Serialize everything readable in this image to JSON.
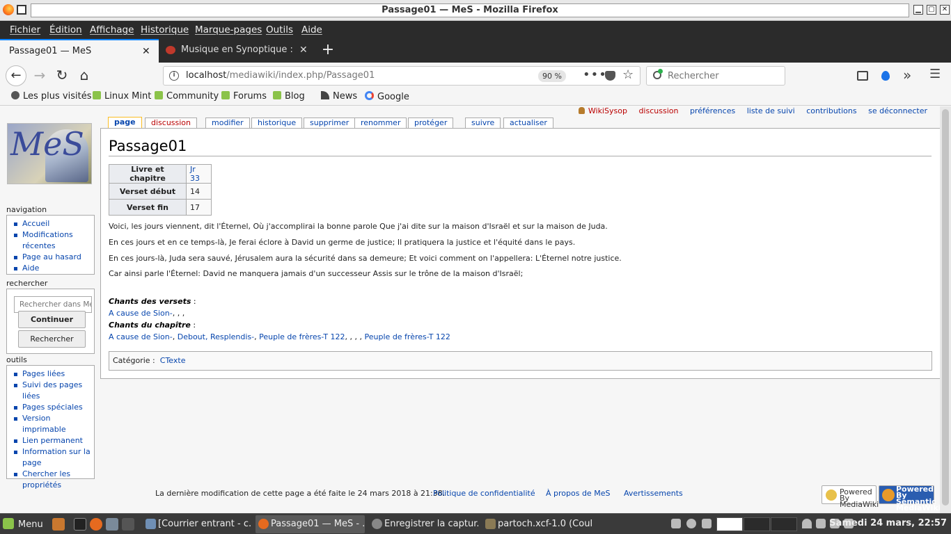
{
  "window": {
    "title": "Passage01 — MeS - Mozilla Firefox"
  },
  "menubar": [
    "Fichier",
    "Édition",
    "Affichage",
    "Historique",
    "Marque-pages",
    "Outils",
    "Aide"
  ],
  "tabs": [
    {
      "label": "Passage01 — MeS",
      "close": "✕"
    },
    {
      "label": "Musique en Synoptique : une",
      "close": "✕"
    }
  ],
  "newtab": "+",
  "nav": {
    "back": "←",
    "forward": "→",
    "reload": "↻",
    "home": "⌂",
    "url_host": "localhost",
    "url_path": "/mediawiki/index.php/Passage01",
    "zoom": "90 %",
    "more": "•••",
    "star": "☆",
    "search_placeholder": "Rechercher",
    "overflow": "»",
    "hamburger": "☰"
  },
  "bookmarks": [
    "Les plus visités",
    "Linux Mint",
    "Community",
    "Forums",
    "Blog",
    "News",
    "Google"
  ],
  "personal": {
    "user": "WikiSysop",
    "items": [
      "discussion",
      "préférences",
      "liste de suivi",
      "contributions",
      "se déconnecter"
    ]
  },
  "content_tabs": [
    "page",
    "discussion",
    "modifier",
    "historique",
    "supprimer",
    "renommer",
    "protéger",
    "suivre",
    "actualiser"
  ],
  "sidebar": {
    "logo_text": "MeS",
    "navigation": {
      "title": "navigation",
      "items": [
        "Accueil",
        "Modifications",
        "récentes",
        "Page au hasard",
        "Aide"
      ]
    },
    "search": {
      "title": "rechercher",
      "placeholder": "Rechercher dans MeS",
      "go": "Continuer",
      "search": "Rechercher"
    },
    "tools": {
      "title": "outils",
      "items": [
        "Pages liées",
        "Suivi des pages",
        "liées",
        "Pages spéciales",
        "Version imprimable",
        "Lien permanent",
        "Information sur la",
        "page",
        "Chercher les",
        "propriétés"
      ]
    }
  },
  "article": {
    "title": "Passage01",
    "infobox": [
      {
        "label": "Livre et chapitre",
        "value": "Jr 33"
      },
      {
        "label": "Verset début",
        "value": "14"
      },
      {
        "label": "Verset fin",
        "value": "17"
      }
    ],
    "verses": [
      "Voici, les jours viennent, dit l'Éternel, Où j'accomplirai la bonne parole Que j'ai dite sur la maison d'Israël et sur la maison de Juda.",
      "En ces jours et en ce temps-là, Je ferai éclore à David un germe de justice; Il pratiquera la justice et l'équité dans le pays.",
      "En ces jours-là, Juda sera sauvé, Jérusalem aura la sécurité dans sa demeure; Et voici comment on l'appellera: L'Éternel notre justice.",
      "Car ainsi parle l'Éternel: David ne manquera jamais d'un successeur Assis sur le trône de la maison d'Israël;"
    ],
    "chants_versets_label": "Chants des versets",
    "chants_chapitre_label": "Chants du chapître",
    "colon": " :",
    "versets_link": "A cause de Sion-",
    "versets_tail": ", , ,",
    "chapitre_links": [
      "A cause de Sion-",
      "Debout, Resplendis-",
      "Peuple de frères-T 122",
      "Peuple de frères-T 122"
    ],
    "sep_comma": ", ",
    "sep_multi": ", , , , ",
    "category_label": "Catégorie :",
    "category_value": "CTexte"
  },
  "footer": {
    "lastmod": "La dernière modification de cette page a été faite le 24 mars 2018 à 21:38.",
    "privacy": "Politique de confidentialité",
    "about": "À propos de MeS",
    "disclaimer": "Avertissements",
    "mw_badge": "Powered By MediaWiki",
    "smw_badge": "Powered By Semantic MediaWiki"
  },
  "taskbar": {
    "menu": "Menu",
    "tasks": [
      "[Courrier entrant - c...",
      "Passage01 — MeS - ...",
      "Enregistrer la captur...",
      "partoch.xcf-1.0 (Coul..."
    ],
    "clock": "Samedi 24 mars, 22:57"
  },
  "colors": {
    "link": "#0645ad",
    "redlink": "#ba0000",
    "accent": "#0a84ff"
  }
}
